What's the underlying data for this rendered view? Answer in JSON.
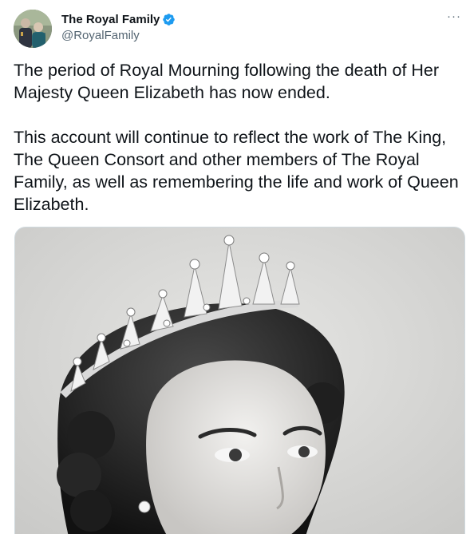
{
  "author": {
    "display_name": "The Royal Family",
    "handle": "@RoyalFamily",
    "verified": true,
    "avatar_icon": "profile-avatar"
  },
  "actions": {
    "more_label": "···"
  },
  "tweet": {
    "paragraphs": [
      "The period of Royal Mourning following the death of Her Majesty Queen Elizabeth has now ended.",
      "This account will continue to reflect the work of The King, The Queen Consort and other members of The Royal Family, as well as remembering the life and work of Queen Elizabeth."
    ]
  },
  "media": {
    "type": "photo",
    "style": "black-and-white portrait",
    "icon": "photo-image"
  },
  "colors": {
    "verified_badge": "#1d9bf0",
    "secondary_text": "#536471",
    "primary_text": "#0f1419",
    "border": "#cfd9de"
  }
}
